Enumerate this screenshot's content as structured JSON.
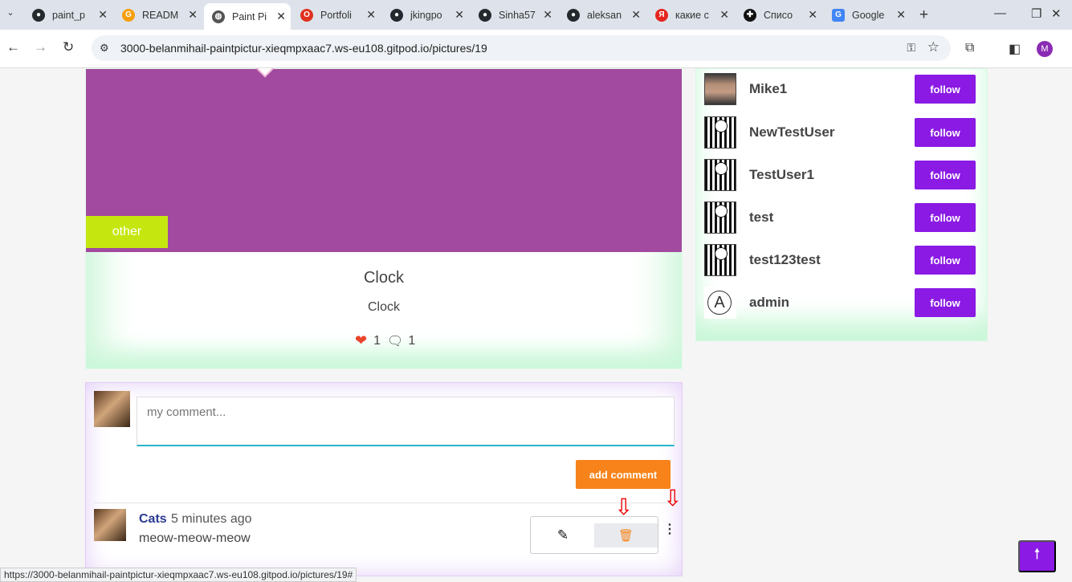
{
  "browser": {
    "tabs": [
      {
        "label": "paint_p",
        "icon": "github-icon",
        "color": "#24292e"
      },
      {
        "label": "READM",
        "icon": "gitpod-icon",
        "color": "#f59e0b"
      },
      {
        "label": "Paint Pi",
        "icon": "globe-icon",
        "color": "#555555"
      },
      {
        "label": "Portfoli",
        "icon": "opera-icon",
        "color": "#e0311f"
      },
      {
        "label": "jkingpo",
        "icon": "github-icon",
        "color": "#24292e"
      },
      {
        "label": "Sinha57",
        "icon": "github-icon",
        "color": "#24292e"
      },
      {
        "label": "aleksan",
        "icon": "github-icon",
        "color": "#24292e"
      },
      {
        "label": "какие с",
        "icon": "yandex-icon",
        "color": "#e52620"
      },
      {
        "label": "Списо",
        "icon": "plus-circle-icon",
        "color": "#111111"
      },
      {
        "label": "Google",
        "icon": "google-translate-icon",
        "color": "#4285f4"
      }
    ],
    "url": "3000-belanmihail-paintpictur-xieqmpxaac7.ws-eu108.gitpod.io/pictures/19",
    "profile_initial": "M",
    "status_url": "https://3000-belanmihail-paintpictur-xieqmpxaac7.ws-eu108.gitpod.io/pictures/19#"
  },
  "picture": {
    "badge": "other",
    "title": "Clock",
    "description": "Clock",
    "likes": "1",
    "comments": "1"
  },
  "users": [
    {
      "name": "Mike1",
      "avatar": "photo",
      "follow_label": "follow"
    },
    {
      "name": "NewTestUser",
      "avatar": "striped",
      "follow_label": "follow"
    },
    {
      "name": "TestUser1",
      "avatar": "striped",
      "follow_label": "follow"
    },
    {
      "name": "test",
      "avatar": "striped",
      "follow_label": "follow"
    },
    {
      "name": "test123test",
      "avatar": "striped",
      "follow_label": "follow"
    },
    {
      "name": "admin",
      "avatar": "anarchy",
      "follow_label": "follow"
    }
  ],
  "comment_form": {
    "placeholder": "my comment...",
    "submit_label": "add comment"
  },
  "comment": {
    "author": "Cats",
    "time": "5 minutes ago",
    "text": "meow-meow-meow"
  },
  "colors": {
    "accent_purple": "#8a1ae4",
    "accent_orange": "#f7831a",
    "picture_bg": "#a14a9f",
    "badge_bg": "#c5e70f"
  }
}
